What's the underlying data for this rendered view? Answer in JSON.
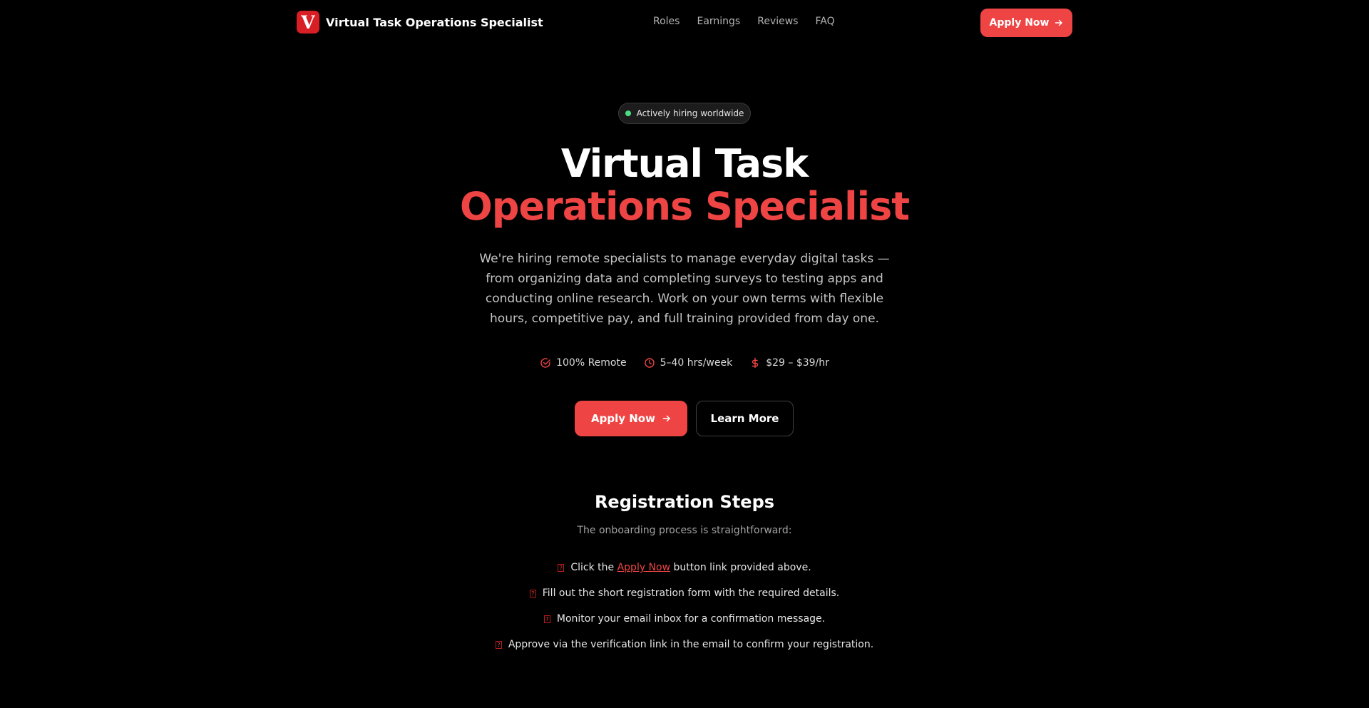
{
  "header": {
    "logo_letter": "V",
    "brand_name": "Virtual Task Operations Specialist",
    "nav": [
      "Roles",
      "Earnings",
      "Reviews",
      "FAQ"
    ],
    "cta_label": "Apply Now"
  },
  "hero": {
    "badge": "Actively hiring worldwide",
    "title_line1": "Virtual Task",
    "title_line2": "Operations Specialist",
    "description": "We're hiring remote specialists to manage everyday digital tasks — from organizing data and completing surveys to testing apps and conducting online research. Work on your own terms with flexible hours, competitive pay, and full training provided from day one.",
    "features": [
      {
        "icon": "check-circle-icon",
        "label": "100% Remote"
      },
      {
        "icon": "clock-icon",
        "label": "5–40 hrs/week"
      },
      {
        "icon": "dollar-icon",
        "label": "$29 – $39/hr"
      }
    ],
    "primary_cta": "Apply Now",
    "secondary_cta": "Learn More"
  },
  "registration": {
    "title": "Registration Steps",
    "subtitle": "The onboarding process is straightforward:",
    "step_marker": "?",
    "step1": {
      "before": "Click the",
      "link": "Apply Now",
      "after": "button link provided above."
    },
    "step2": "Fill out the short registration form with the required details.",
    "step3": "Monitor your email inbox for a confirmation message.",
    "step4": "Approve via the verification link in the email to confirm your registration."
  },
  "colors": {
    "accent": "#ef4444",
    "logo_bg": "#d91f26",
    "status_dot": "#4ade80",
    "background": "#000000"
  }
}
